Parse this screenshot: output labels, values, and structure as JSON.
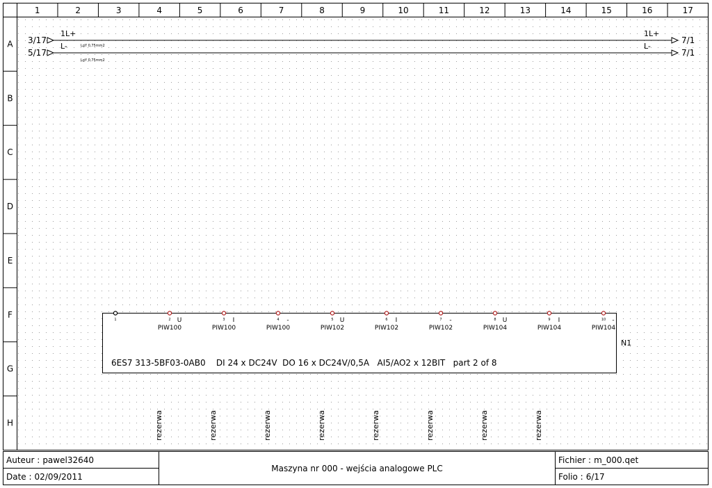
{
  "frame": {
    "columns": [
      "1",
      "2",
      "3",
      "4",
      "5",
      "6",
      "7",
      "8",
      "9",
      "10",
      "11",
      "12",
      "13",
      "14",
      "15",
      "16",
      "17"
    ],
    "rows": [
      "A",
      "B",
      "C",
      "D",
      "E",
      "F",
      "G",
      "H"
    ]
  },
  "buses": [
    {
      "name": "1L+",
      "from_ref": "3/17",
      "to_ref": "7/1",
      "end_label": "1L+",
      "cable": "LgY 0,75mm2"
    },
    {
      "name": "L-",
      "from_ref": "5/17",
      "to_ref": "7/1",
      "end_label": "L-",
      "cable": "LgY 0,75mm2"
    }
  ],
  "plc": {
    "tag": "N1",
    "description": "6ES7 313-5BF03-0AB0    DI 24 x DC24V  DO 16 x DC24V/0,5A   AI5/AO2 x 12BIT   part 2 of 8",
    "terminals": [
      {
        "num": "1",
        "type": "",
        "label": ""
      },
      {
        "num": "2",
        "type": "U",
        "label": "PIW100"
      },
      {
        "num": "3",
        "type": "I",
        "label": "PIW100"
      },
      {
        "num": "4",
        "type": "-",
        "label": "PIW100"
      },
      {
        "num": "5",
        "type": "U",
        "label": "PIW102"
      },
      {
        "num": "6",
        "type": "I",
        "label": "PIW102"
      },
      {
        "num": "7",
        "type": "-",
        "label": "PIW102"
      },
      {
        "num": "8",
        "type": "U",
        "label": "PIW104"
      },
      {
        "num": "9",
        "type": "I",
        "label": "PIW104"
      },
      {
        "num": "10",
        "type": "-",
        "label": "PIW104"
      }
    ]
  },
  "reserves": [
    "rezerwa",
    "rezerwa",
    "rezerwa",
    "rezerwa",
    "rezerwa",
    "rezerwa",
    "rezerwa",
    "rezerwa"
  ],
  "cartouche": {
    "author_label": "Auteur :",
    "author": "pawel32640",
    "date_label": "Date :",
    "date": "02/09/2011",
    "title": "Maszyna nr 000 - wejścia analogowe PLC",
    "file_label": "Fichier :",
    "file": "m_000.qet",
    "folio_label": "Folio :",
    "folio": "6/17"
  },
  "colors": {
    "line": "#000000",
    "grid_dot": "#9a9a9a",
    "terminal_dot": "#b02020",
    "background": "#ffffff"
  }
}
